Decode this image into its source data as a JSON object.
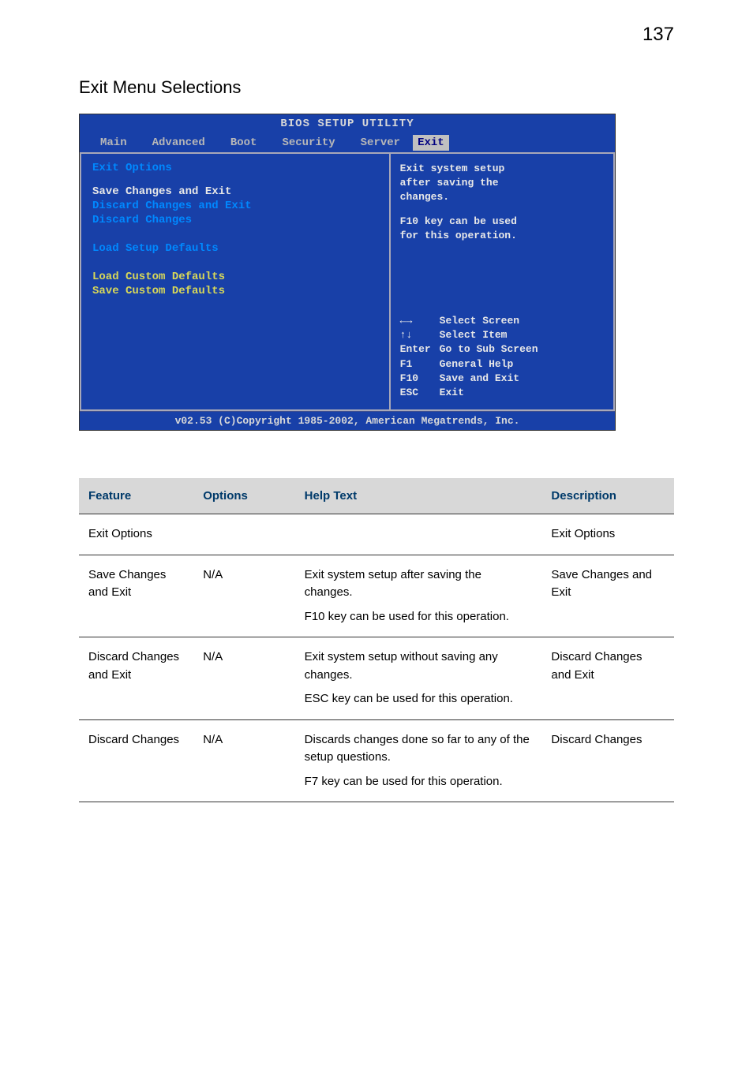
{
  "page_number": "137",
  "section_title": "Exit Menu Selections",
  "bios": {
    "title": "BIOS SETUP UTILITY",
    "tabs": {
      "t0": "Main",
      "t1": "Advanced",
      "t2": "Boot",
      "t3": "Security",
      "t4": "Server",
      "t5": "Exit"
    },
    "left": {
      "heading": "Exit Options",
      "items": [
        {
          "label": "Save Changes and Exit",
          "cls": "menu-white"
        },
        {
          "label": "Discard Changes and Exit",
          "cls": "menu-blue"
        },
        {
          "label": "Discard Changes",
          "cls": "menu-blue"
        },
        {
          "label": "",
          "cls": ""
        },
        {
          "label": "Load Setup Defaults",
          "cls": "menu-blue"
        },
        {
          "label": "",
          "cls": ""
        },
        {
          "label": "Load Custom Defaults",
          "cls": "menu-yellow"
        },
        {
          "label": "Save Custom Defaults",
          "cls": "menu-yellow"
        }
      ]
    },
    "help": {
      "line1": "Exit system setup",
      "line2": "after saving the",
      "line3": "changes.",
      "line4": "F10 key can be used",
      "line5": "for this operation."
    },
    "nav": [
      {
        "key": "←→",
        "label": "Select Screen"
      },
      {
        "key": "↑↓",
        "label": "Select Item"
      },
      {
        "key": "Enter",
        "label": "Go to Sub Screen"
      },
      {
        "key": "F1",
        "label": "General Help"
      },
      {
        "key": "F10",
        "label": "Save and Exit"
      },
      {
        "key": "ESC",
        "label": "Exit"
      }
    ],
    "footer": "v02.53 (C)Copyright 1985-2002, American Megatrends, Inc."
  },
  "table": {
    "headers": {
      "feature": "Feature",
      "options": "Options",
      "help": "Help Text",
      "description": "Description"
    },
    "rows": [
      {
        "feature": "Exit Options",
        "options": "",
        "help": "",
        "description": "Exit Options"
      },
      {
        "feature": "Save Changes and Exit",
        "options": "N/A",
        "help": "Exit system setup after saving the changes.\nF10 key can be used for this operation.",
        "description": "Save Changes and Exit"
      },
      {
        "feature": "Discard Changes and Exit",
        "options": "N/A",
        "help": "Exit system setup without saving any changes.\nESC key can be used for this operation.",
        "description": "Discard Changes and Exit"
      },
      {
        "feature": "Discard Changes",
        "options": "N/A",
        "help": "Discards changes done so far to any of the setup questions.\nF7 key can be used for this operation.",
        "description": "Discard Changes"
      }
    ]
  }
}
